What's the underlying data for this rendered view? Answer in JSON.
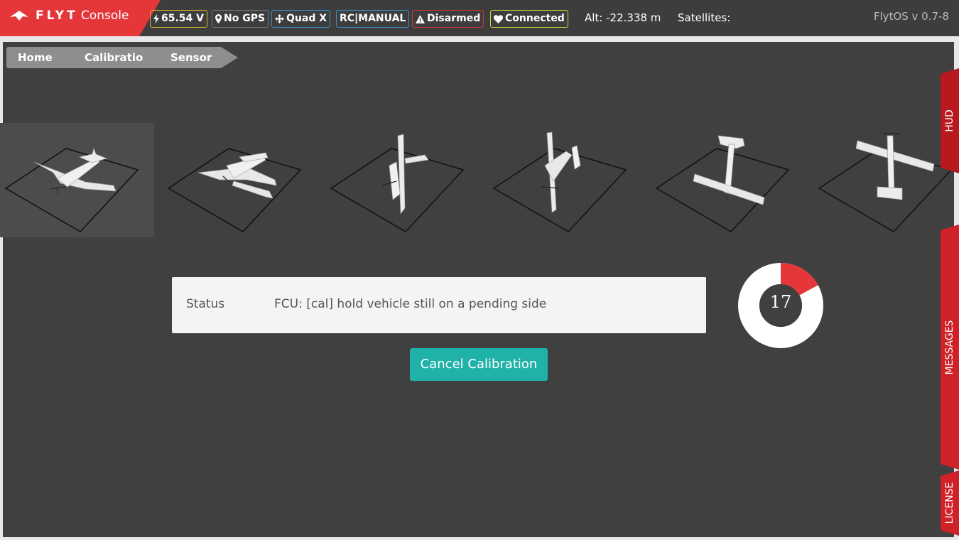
{
  "brand": {
    "flyt": "FLYT",
    "console": "Console"
  },
  "status_bar": {
    "voltage": "65.54 V",
    "gps": "No GPS",
    "frame": "Quad X",
    "mode": "RC|MANUAL",
    "arm": "Disarmed",
    "connection": "Connected",
    "altitude": "Alt: -22.338 m",
    "satellites": "Satellites:",
    "version": "FlytOS v 0.7-8"
  },
  "breadcrumb": [
    "Home",
    "Calibratio",
    "Sensor"
  ],
  "orientations": {
    "count": 6,
    "active_index": 0
  },
  "status": {
    "label": "Status",
    "text": "FCU: [cal] hold vehicle still on a pending side"
  },
  "cancel_button": "Cancel Calibration",
  "progress": {
    "value": 17,
    "percent": 17,
    "fill_color": "#e5373a"
  },
  "side_tabs": [
    "HUD",
    "MESSAGES",
    "LICENSE"
  ],
  "colors": {
    "brand": "#e5373a",
    "accent": "#20b2a9"
  }
}
